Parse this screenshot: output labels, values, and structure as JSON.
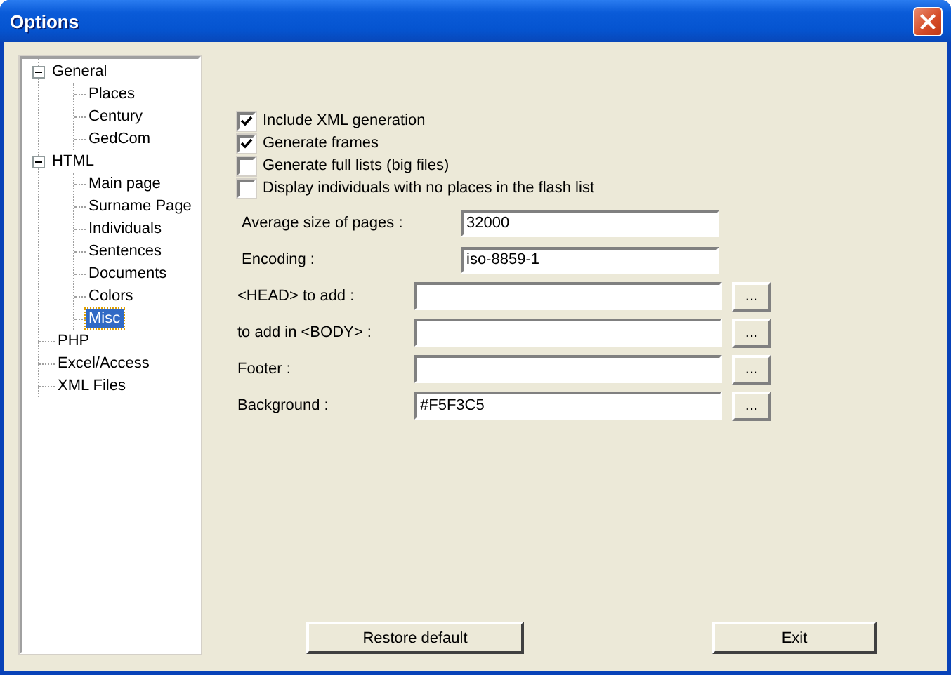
{
  "window": {
    "title": "Options"
  },
  "tree": [
    {
      "label": "General",
      "selected": false,
      "expanded": true,
      "children": [
        {
          "label": "Places",
          "selected": false
        },
        {
          "label": "Century",
          "selected": false
        },
        {
          "label": "GedCom",
          "selected": false
        }
      ]
    },
    {
      "label": "HTML",
      "selected": false,
      "expanded": true,
      "children": [
        {
          "label": "Main page",
          "selected": false
        },
        {
          "label": "Surname Page",
          "selected": false
        },
        {
          "label": "Individuals",
          "selected": false
        },
        {
          "label": "Sentences",
          "selected": false
        },
        {
          "label": "Documents",
          "selected": false
        },
        {
          "label": "Colors",
          "selected": false
        },
        {
          "label": "Misc",
          "selected": true
        }
      ]
    },
    {
      "label": "PHP",
      "selected": false
    },
    {
      "label": "Excel/Access",
      "selected": false
    },
    {
      "label": "XML Files",
      "selected": false
    }
  ],
  "options": [
    {
      "label": "Include XML generation",
      "checked": true
    },
    {
      "label": "Generate frames",
      "checked": true
    },
    {
      "label": "Generate full lists (big files)",
      "checked": false
    },
    {
      "label": "Display individuals with no places in the flash list",
      "checked": false
    }
  ],
  "fields": [
    {
      "label": "Average size of pages :",
      "value": "32000"
    },
    {
      "label": "Encoding :",
      "value": "iso-8859-1"
    },
    {
      "label": "<HEAD> to add :",
      "button": "..."
    },
    {
      "label": "to add in <BODY> :",
      "button": "..."
    },
    {
      "label": "Footer :",
      "button": "..."
    },
    {
      "label": "Background :",
      "value": "#F5F3C5",
      "button": "..."
    }
  ],
  "buttons": [
    "Restore default",
    "Exit"
  ]
}
